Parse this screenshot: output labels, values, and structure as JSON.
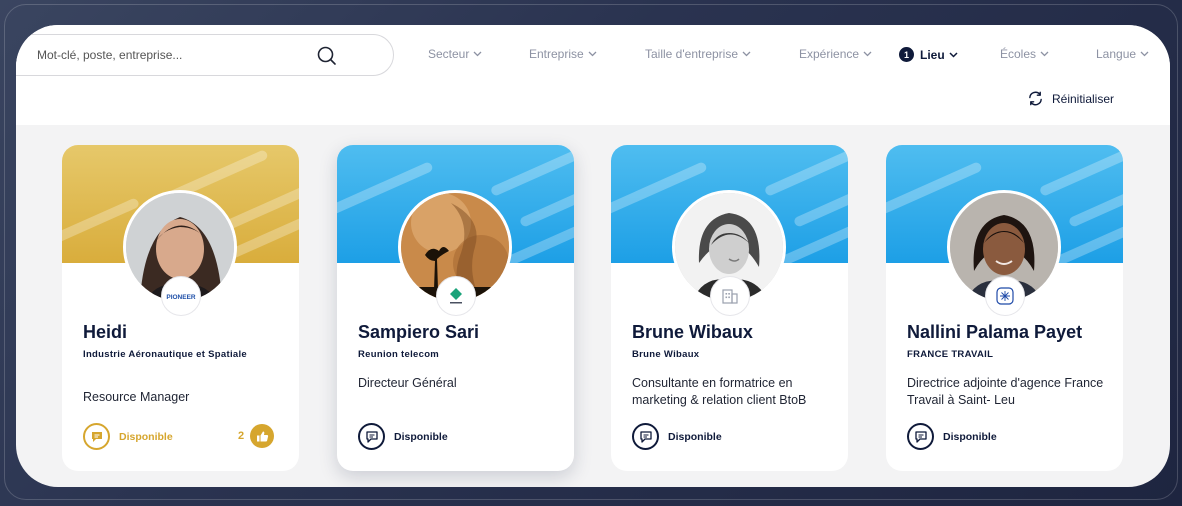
{
  "search": {
    "value": "Mot-clé, poste, entreprise..."
  },
  "filters": [
    {
      "label": "Secteur",
      "active": false
    },
    {
      "label": "Entreprise",
      "active": false
    },
    {
      "label": "Taille d'entreprise",
      "active": false
    },
    {
      "label": "Expérience",
      "active": false
    },
    {
      "label": "Lieu",
      "active": true,
      "count": "1"
    },
    {
      "label": "Écoles",
      "active": false
    },
    {
      "label": "Langue",
      "active": false
    }
  ],
  "reset_label": "Réinitialiser",
  "colors": {
    "navy": "#0f1a3a",
    "gold": "#d6a62e",
    "blue_banner": "#1d9fe6"
  },
  "cards": [
    {
      "name": "Heidi",
      "company": "Industrie Aéronautique et Spatiale",
      "role": "Resource Manager",
      "status": "Disponible",
      "likes": "2",
      "logo_text": "PIONEER",
      "banner": "gold"
    },
    {
      "name": "Sampiero Sari",
      "company": "Reunion telecom",
      "role": "Directeur Général",
      "status": "Disponible",
      "banner": "blue"
    },
    {
      "name": "Brune Wibaux",
      "company": "Brune Wibaux",
      "role": "Consultante en formatrice en marketing & relation client BtoB",
      "status": "Disponible",
      "banner": "blue"
    },
    {
      "name": "Nallini Palama Payet",
      "company": "FRANCE TRAVAIL",
      "role": "Directrice adjointe d'agence France Travail à Saint- Leu",
      "status": "Disponible",
      "banner": "blue"
    }
  ]
}
